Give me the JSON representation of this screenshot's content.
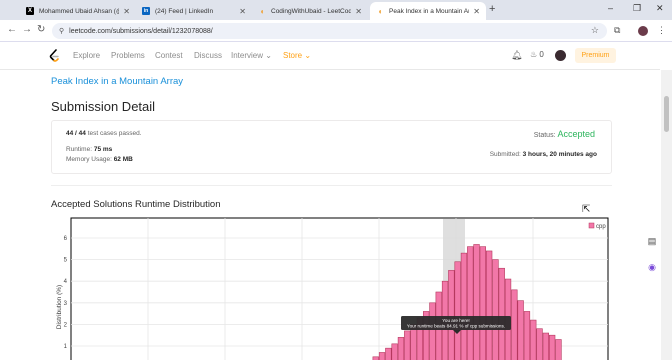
{
  "browser": {
    "tabs": [
      {
        "label": "Mohammed Ubaid Ahsan (@co",
        "icon": "x-icon",
        "active": false
      },
      {
        "label": "(24) Feed | LinkedIn",
        "icon": "linkedin-icon",
        "active": false
      },
      {
        "label": "CodingWithUbaid - LeetCode P",
        "icon": "leetcode-icon",
        "active": false
      },
      {
        "label": "Peak Index in a Mountain Arra",
        "icon": "leetcode-icon",
        "active": true
      }
    ],
    "new_tab": "+",
    "window_controls": {
      "minimize": "–",
      "maximize": "❐",
      "close": "✕"
    },
    "url": "leetcode.com/submissions/detail/1232078088/"
  },
  "navbar": {
    "links": [
      "Explore",
      "Problems",
      "Contest",
      "Discuss",
      "Interview",
      "Store"
    ],
    "streak_count": "0",
    "premium_label": "Premium",
    "store_color": "#ffa116"
  },
  "page": {
    "problem_link": "Peak Index in a Mountain Array",
    "title": "Submission Detail",
    "card": {
      "tests_prefix": "44 / 44",
      "tests_suffix": " test cases passed.",
      "runtime_label": "Runtime: ",
      "runtime_value": "75 ms",
      "memory_label": "Memory Usage: ",
      "memory_value": "62 MB",
      "status_label": "Status: ",
      "status_value": "Accepted",
      "submitted_label": "Submitted: ",
      "submitted_value": "3 hours, 20 minutes ago"
    },
    "distribution_title": "Accepted Solutions Runtime Distribution"
  },
  "colors": {
    "accent_green": "#2db55d",
    "link_blue": "#1a90d9",
    "bar_fill": "#f277a8",
    "bar_stroke": "#b5385e",
    "highlight": "#d9d9d9"
  },
  "chart_data": {
    "type": "bar",
    "ylabel": "Distribution (%)",
    "legend": "cpp",
    "legend_position": "top-right",
    "yticks": [
      1,
      2,
      3,
      4,
      5,
      6
    ],
    "ylim": [
      0,
      6.6
    ],
    "grid": true,
    "values": [
      0.1,
      0.2,
      0.3,
      0.5,
      0.7,
      0.9,
      1.1,
      1.4,
      1.7,
      2.0,
      2.3,
      2.6,
      3.0,
      3.5,
      4.0,
      4.5,
      4.9,
      5.3,
      5.6,
      5.7,
      5.6,
      5.4,
      5.0,
      4.6,
      4.1,
      3.6,
      3.1,
      2.6,
      2.2,
      1.8,
      1.6,
      1.5,
      1.3
    ],
    "tooltip": {
      "line1": "You are here!",
      "line2": "Your runtime beats 84.91 % of cpp submissions."
    }
  }
}
